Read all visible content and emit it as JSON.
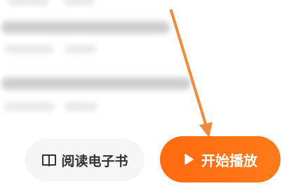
{
  "bottom_bar": {
    "ebook_label": "阅读电子书",
    "play_label": "开始播放"
  },
  "icons": {
    "ebook": "open-book-icon",
    "play": "play-icon",
    "annotation": "arrow-icon"
  },
  "colors": {
    "accent": "#ff6a10",
    "annotation_arrow": "#f08a3c",
    "ebook_button_bg": "#f5f5f5"
  }
}
